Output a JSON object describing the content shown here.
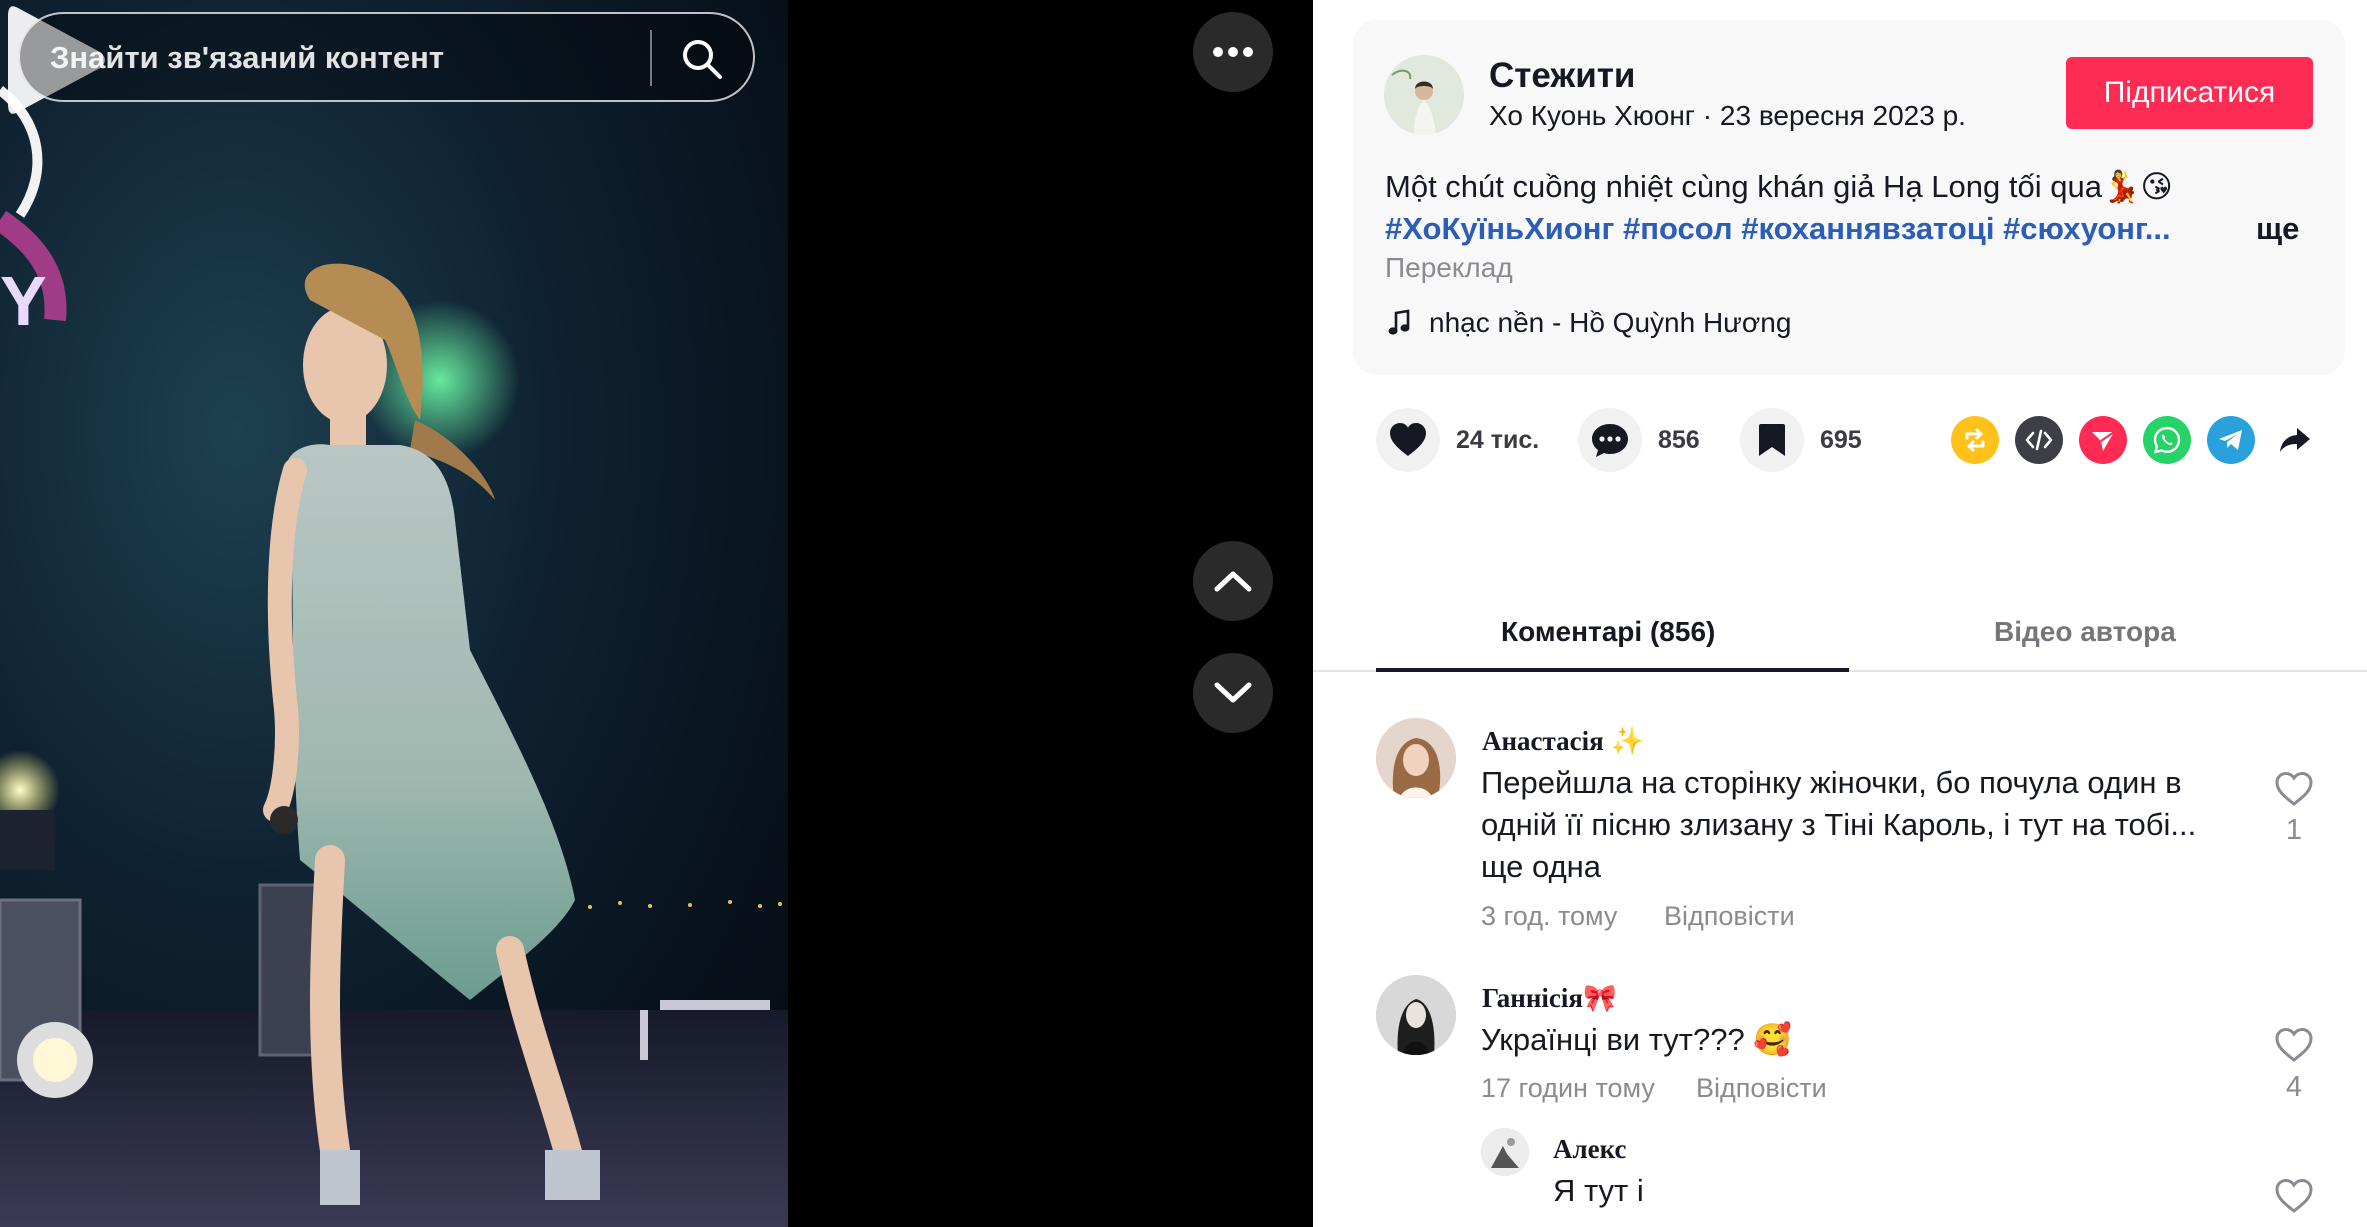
{
  "search": {
    "placeholder": "Знайти зв'язаний контент"
  },
  "video": {
    "state": "paused"
  },
  "post": {
    "author_name": "Стежити",
    "author_handle": "Хо Куонь Хюонг",
    "date": "23 вересня 2023 р.",
    "follow_label": "Підписатися",
    "caption": "Một chút cuồng nhiệt cùng khán giả Hạ Long tối qua💃😘",
    "hashtags": "#ХоКуїньХионг #посол #коханнявзатоці #сюхуонг...",
    "more_label": "ще",
    "translate_label": "Переклад",
    "music": "nhạc nền - Hồ Quỳnh Hương"
  },
  "stats": {
    "likes": "24 тис.",
    "comments": "856",
    "saves": "695"
  },
  "share_icons": [
    "repost-icon",
    "embed-icon",
    "send-icon",
    "whatsapp-icon",
    "telegram-icon",
    "share-arrow-icon"
  ],
  "tabs": {
    "comments": "Коментарі (856)",
    "author_videos": "Відео автора"
  },
  "comments": [
    {
      "name": "Анастасія ✨",
      "text": "Перейшла на сторінку жіночки, бо почула один в одній її пісню злизану з Тіні Кароль, і тут на тобі... ще одна",
      "time": "3 год. тому",
      "reply": "Відповісти",
      "likes": "1"
    },
    {
      "name": "Ганнісія🎀",
      "text": "Українці ви тут??? 🥰",
      "time": "17 годин тому",
      "reply": "Відповісти",
      "likes": "4"
    },
    {
      "name": "Алекс",
      "text": "Я тут і"
    }
  ],
  "colors": {
    "accent": "#fe2c55",
    "hashtag": "#2b5db9",
    "muted": "#8a8b91"
  }
}
